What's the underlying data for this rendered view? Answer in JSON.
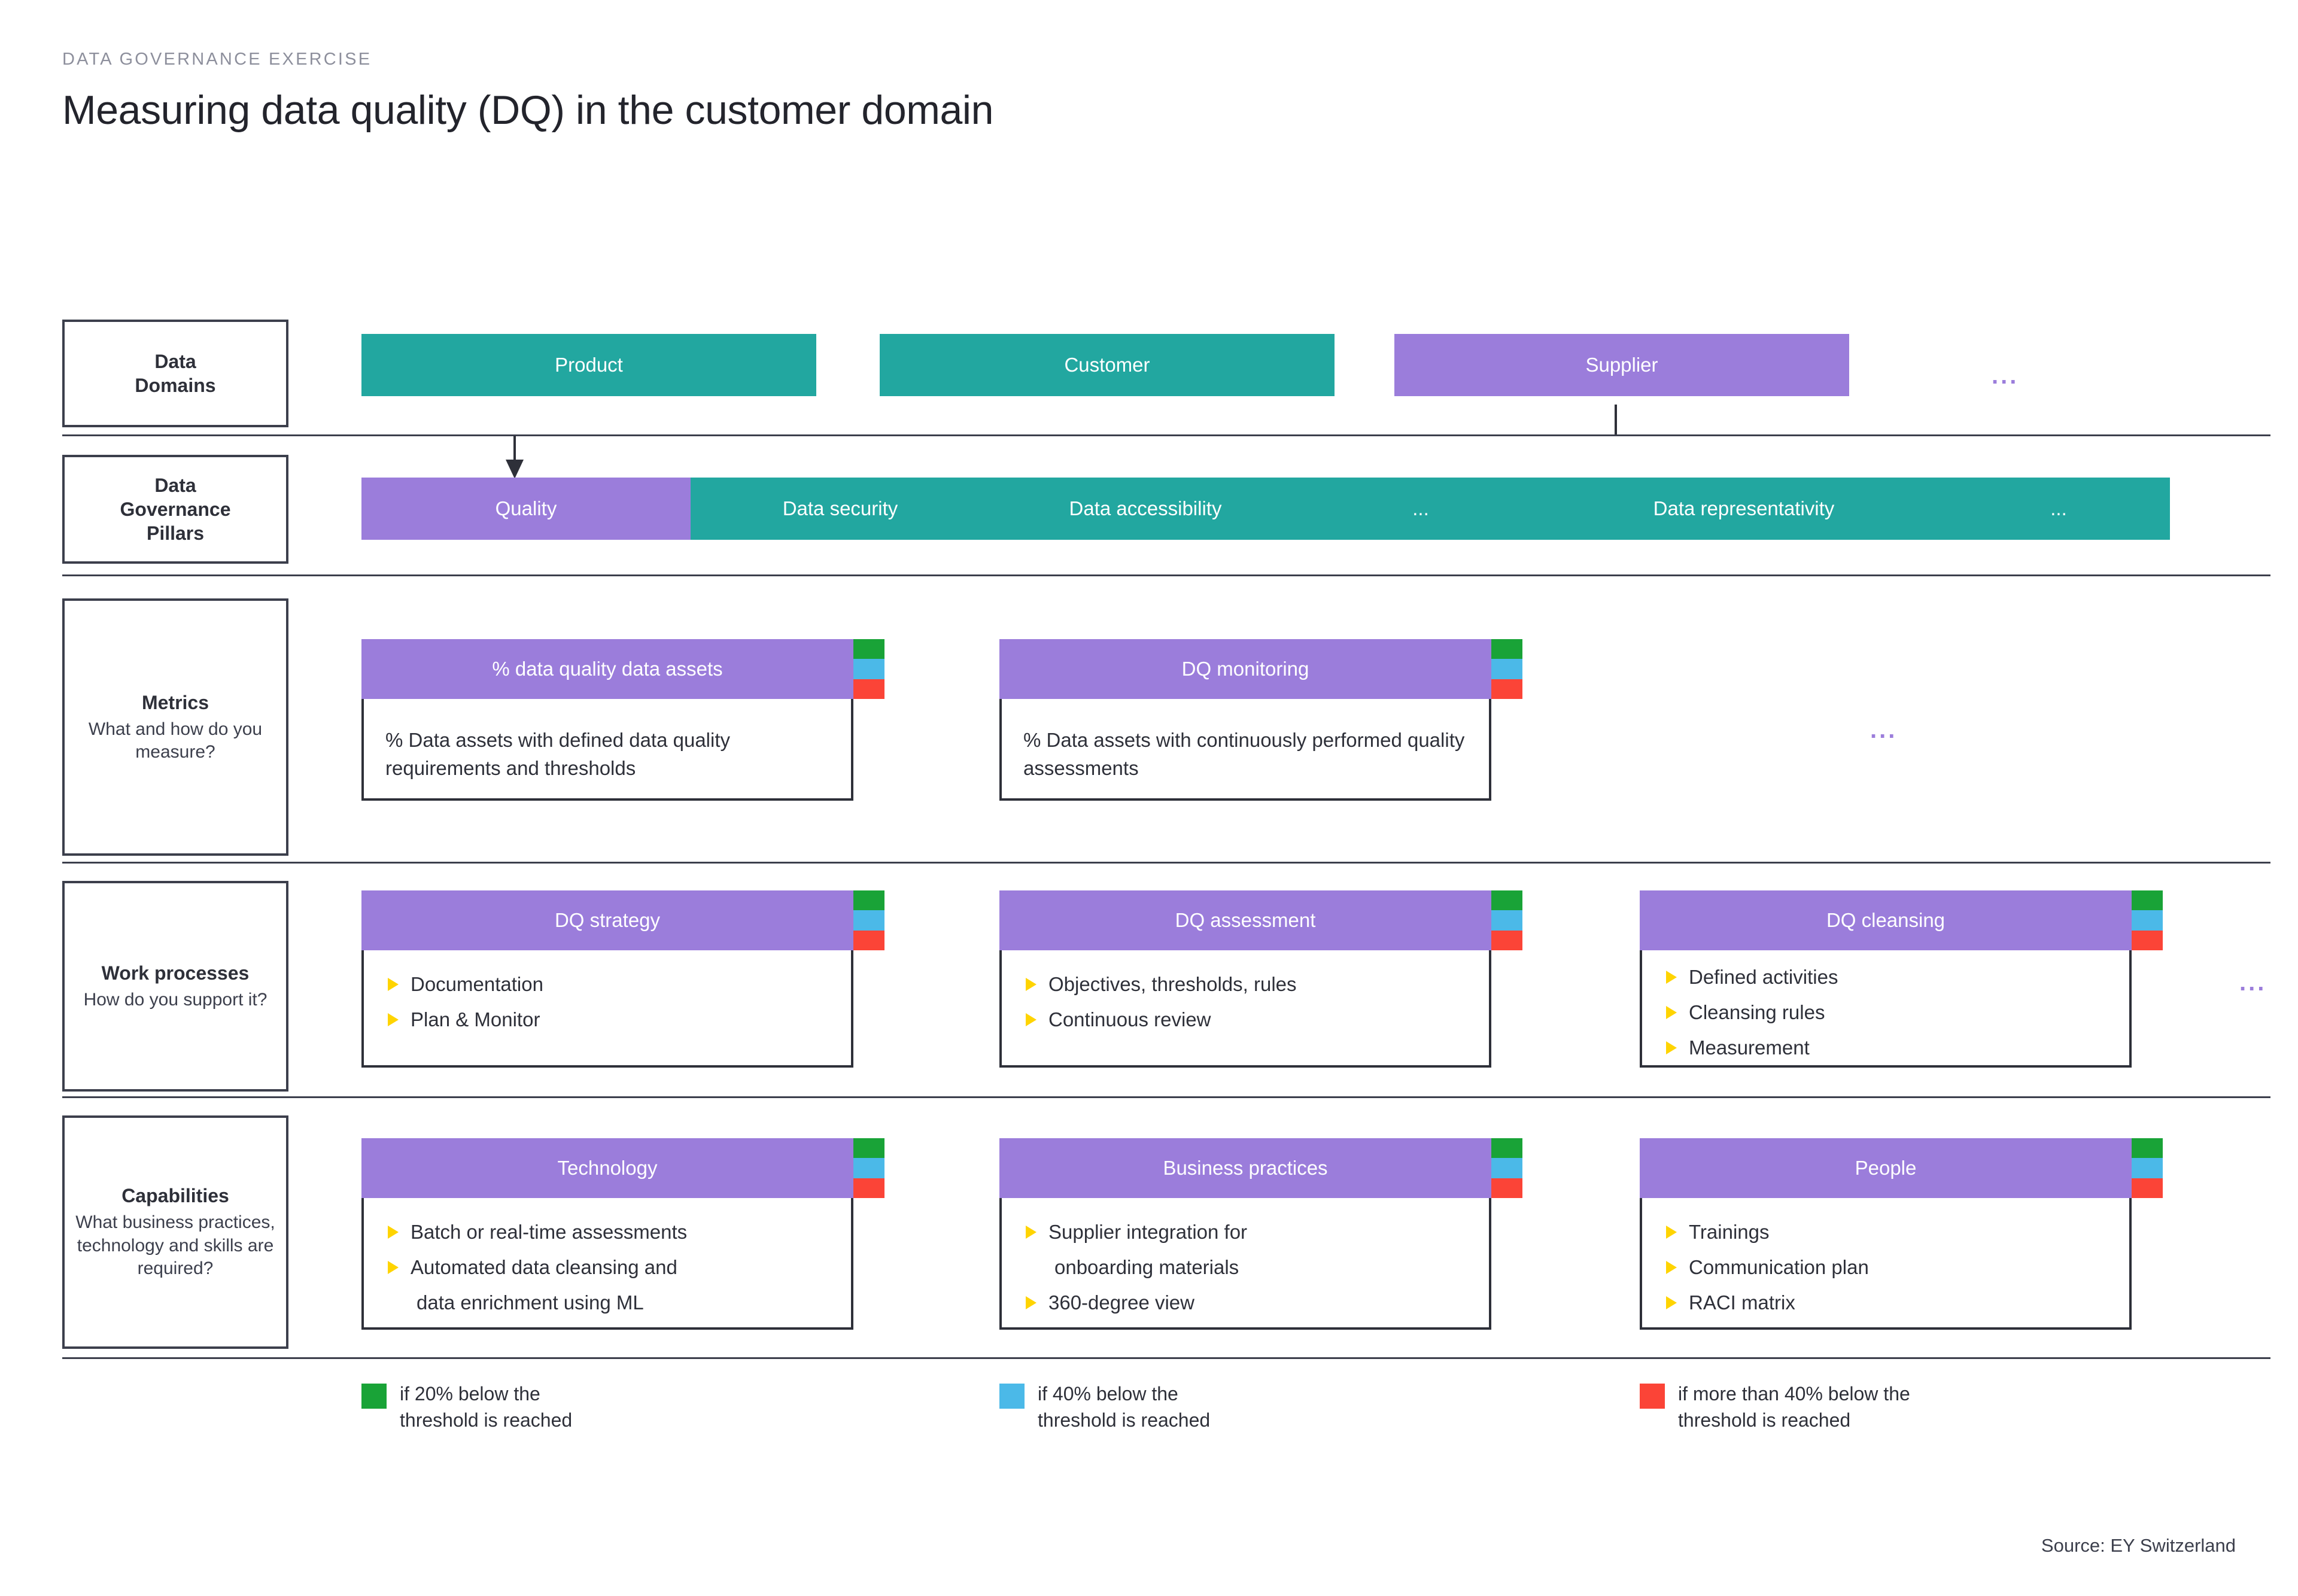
{
  "header": {
    "eyebrow": "DATA GOVERNANCE EXERCISE",
    "title": "Measuring data quality (DQ) in the customer domain"
  },
  "colors": {
    "teal": "#22a7a0",
    "purple": "#9b7ddb",
    "green": "#19a337",
    "blue": "#4bb9e8",
    "red": "#fb4437",
    "bullet_yellow": "#ffd400",
    "ink": "#2e3039"
  },
  "rows": {
    "data_domains": {
      "label_title": "Data",
      "label_title2": "Domains",
      "chips": [
        {
          "label": "Product",
          "color": "teal"
        },
        {
          "label": "Customer",
          "color": "teal"
        },
        {
          "label": "Supplier",
          "color": "purple"
        }
      ],
      "ellipsis": "..."
    },
    "pillars": {
      "label_title": "Data",
      "label_title2": "Governance",
      "label_title3": "Pillars",
      "items": [
        {
          "label": "Quality",
          "active": true
        },
        {
          "label": "Data security",
          "active": false
        },
        {
          "label": "Data accessibility",
          "active": false
        },
        {
          "label": "...",
          "active": false
        },
        {
          "label": "Data representativity",
          "active": false
        },
        {
          "label": "...",
          "active": false
        }
      ]
    },
    "metrics": {
      "label_title": "Metrics",
      "label_sub": "What and how do you measure?",
      "ellipsis": "...",
      "cards": [
        {
          "title": "% data quality data assets",
          "description": "% Data assets with defined data quality requirements and thresholds"
        },
        {
          "title": "DQ monitoring",
          "description": "% Data assets with continuously performed quality assessments"
        }
      ]
    },
    "work_processes": {
      "label_title": "Work processes",
      "label_sub": "How do you support it?",
      "ellipsis": "...",
      "cards": [
        {
          "title": "DQ strategy",
          "bullets": [
            "Documentation",
            "Plan & Monitor"
          ]
        },
        {
          "title": "DQ assessment",
          "bullets": [
            "Objectives, thresholds, rules",
            "Continuous review"
          ]
        },
        {
          "title": "DQ cleansing",
          "bullets": [
            "Defined activities",
            "Cleansing rules",
            "Measurement"
          ]
        }
      ]
    },
    "capabilities": {
      "label_title": "Capabilities",
      "label_sub": "What business practices, technology and skills are required?",
      "cards": [
        {
          "title": "Technology",
          "bullets": [
            "Batch or real-time assessments",
            "Automated data cleansing and"
          ],
          "continuation": "data enrichment using ML"
        },
        {
          "title": "Business practices",
          "bullets": [
            "Supplier integration for",
            "360-degree view"
          ],
          "continuation": "onboarding materials"
        },
        {
          "title": "People",
          "bullets": [
            "Trainings",
            "Communication plan",
            "RACI matrix"
          ]
        }
      ]
    }
  },
  "legend": [
    {
      "color": "green",
      "line1": "if 20% below the",
      "line2": "threshold is reached"
    },
    {
      "color": "blue",
      "line1": "if 40% below the",
      "line2": "threshold is reached"
    },
    {
      "color": "red",
      "line1": "if more than 40% below the",
      "line2": "threshold is reached"
    }
  ],
  "source": "Source: EY Switzerland"
}
